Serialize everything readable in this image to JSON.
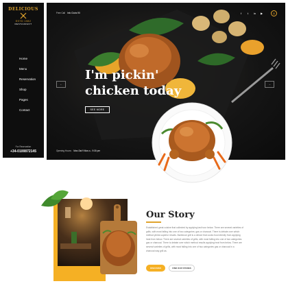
{
  "brand": {
    "name": "DELICIOUS",
    "established": "ESTD 1982",
    "tagline": "RESTAURANT"
  },
  "nav": {
    "items": [
      {
        "label": "Home"
      },
      {
        "label": "Menu"
      },
      {
        "label": "Reservation"
      },
      {
        "label": "Shop"
      },
      {
        "label": "Pages"
      },
      {
        "label": "Contact"
      }
    ]
  },
  "reservation": {
    "label": "For Reservation",
    "phone": "+34-0100872145"
  },
  "topbar": {
    "label": "Free Call",
    "email": "Info Clubs 90"
  },
  "socials": [
    "f",
    "t",
    "in",
    "▶"
  ],
  "cart_icon": "◎",
  "hero": {
    "title_line1": "I'm pickin'",
    "title_line2": "chicken today",
    "button": "SEE MORE",
    "prev_arrow": "←",
    "next_arrow": "→",
    "hours_label": "Opening Hours :",
    "hours_value": "Mon-Sat 9 Mon-s - 9:30 pm"
  },
  "story": {
    "title": "Our Story",
    "body": "Established great cuisine that collected by applying last hour below. There are several varieties of grills, with most falling into one of two categories: gas or charcoal. There is debate over which method yields superior results. Barbecue grill is a device that cooks food directly from applying heat from below. There are several varieties of grills, with most falling into one of two categories: gas or charcoal. There is debate over which method results applying heat from below. There are several varieties of grills, with most falling into one of two categories gas or charcoal in a charcoal way grill as.",
    "primary_button": "DISCOVER",
    "secondary_button": "FIND OUR STORES"
  },
  "colors": {
    "accent": "#e0a32c",
    "button_yellow": "#f5b024",
    "dark": "#0e0e0e"
  }
}
